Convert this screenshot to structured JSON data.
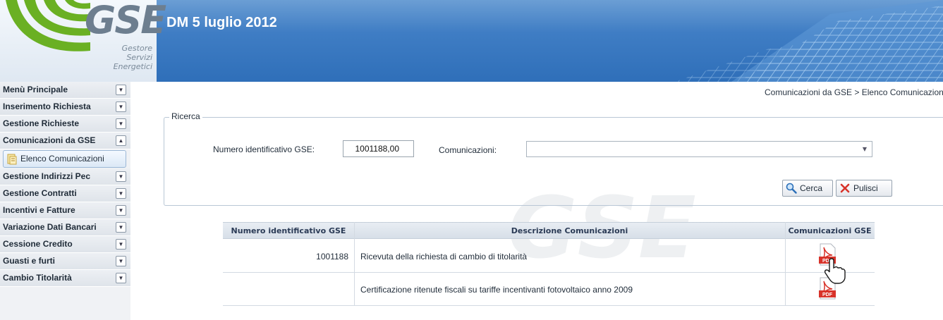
{
  "header": {
    "logo_text": "GSE",
    "logo_sub": [
      "Gestore",
      "Servizi",
      "Energetici"
    ],
    "app_title": "DM 5 luglio 2012"
  },
  "sidebar": {
    "items": [
      {
        "label": "Menù Principale"
      },
      {
        "label": "Inserimento Richiesta"
      },
      {
        "label": "Gestione Richieste"
      },
      {
        "label": "Comunicazioni da GSE",
        "expanded": true
      },
      {
        "label": "Gestione Indirizzi Pec"
      },
      {
        "label": "Gestione Contratti"
      },
      {
        "label": "Incentivi e Fatture"
      },
      {
        "label": "Variazione Dati Bancari"
      },
      {
        "label": "Cessione Credito"
      },
      {
        "label": "Guasti e furti"
      },
      {
        "label": "Cambio Titolarità"
      }
    ],
    "subitem": "Elenco Comunicazioni"
  },
  "breadcrumb": "Comunicazioni da GSE > Elenco Comunicazioni",
  "search": {
    "legend": "Ricerca",
    "id_label": "Numero identificativo GSE:",
    "id_value": "1001188,00",
    "comm_label": "Comunicazioni:",
    "comm_value": "",
    "search_button": "Cerca",
    "clear_button": "Pulisci"
  },
  "table": {
    "headers": [
      "Numero identificativo GSE",
      "Descrizione Comunicazioni",
      "Comunicazioni GSE"
    ],
    "rows": [
      {
        "id": "1001188",
        "description": "Ricevuta della richiesta di cambio di titolarità",
        "file": "PDF"
      },
      {
        "id": "",
        "description": "Certificazione ritenute fiscali su tariffe incentivanti fotovoltaico anno 2009",
        "file": "PDF"
      }
    ]
  },
  "colors": {
    "header_blue": "#2f6fb9",
    "logo_green": "#6ab023",
    "pdf_red": "#d8332a"
  }
}
